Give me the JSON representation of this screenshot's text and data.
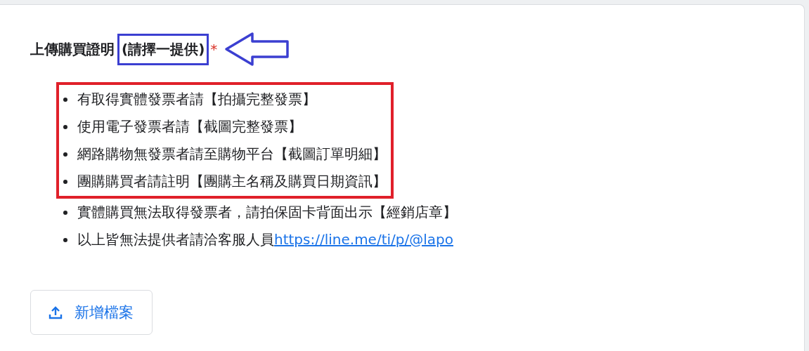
{
  "title": {
    "text": "上傳購買證明",
    "note": "(請擇一提供)",
    "note_highlighted": true,
    "required_mark": "*"
  },
  "items": [
    {
      "text": "有取得實體發票者請【拍攝完整發票】",
      "highlighted": true
    },
    {
      "text": "使用電子發票者請【截圖完整發票】",
      "highlighted": true
    },
    {
      "text": "網路購物無發票者請至購物平台【截圖訂單明細】",
      "highlighted": true
    },
    {
      "text": "團購購買者請註明【團購主名稱及購買日期資訊】",
      "highlighted": true
    },
    {
      "text": "實體購買無法取得發票者，請拍保固卡背面出示【經銷店章】",
      "highlighted": false
    },
    {
      "text": "以上皆無法提供者請洽客服人員",
      "link": "https://line.me/ti/p/@lapo",
      "highlighted": false
    }
  ],
  "upload_button": {
    "label": "新增檔案"
  }
}
